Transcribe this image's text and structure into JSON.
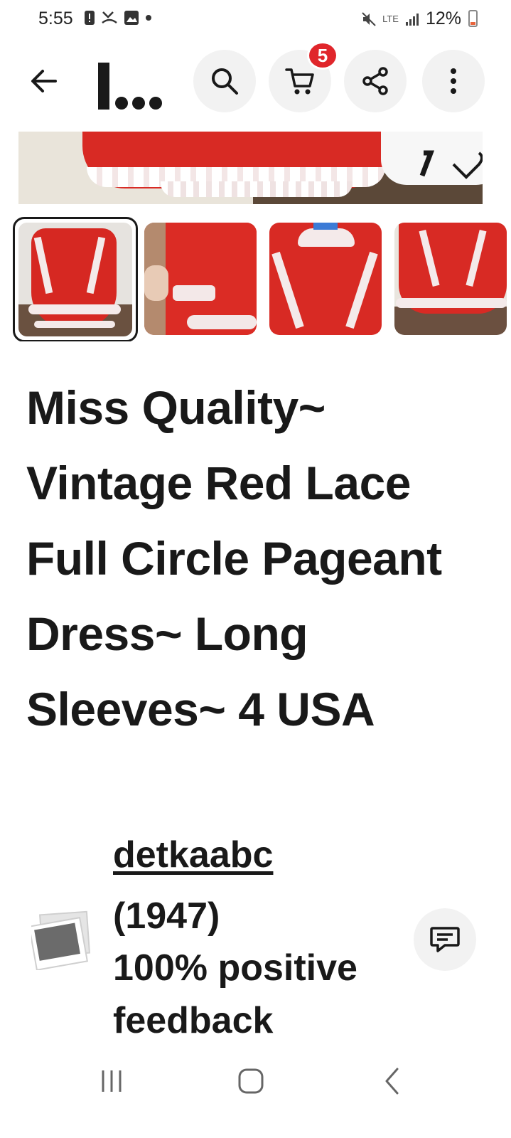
{
  "status_bar": {
    "time": "5:55",
    "network": "LTE",
    "battery": "12%",
    "icons_left": [
      "alert-icon",
      "missed-call-icon",
      "gallery-icon",
      "dot-icon"
    ],
    "icons_right": [
      "mute-icon",
      "signal-icon",
      "battery-icon"
    ]
  },
  "header": {
    "logo_icon": "ebay-logo-icon",
    "cart_count": "5",
    "icons": [
      "back-arrow-icon",
      "search-icon",
      "cart-icon",
      "share-icon",
      "more-vertical-icon"
    ]
  },
  "gallery": {
    "thumbnail_count": 4,
    "selected_index": 0
  },
  "listing": {
    "title": "Miss Quality~ Vintage Red Lace Full Circle Pageant Dress~ Long Sleeves~ 4 USA"
  },
  "seller": {
    "name": "detkaabc",
    "score": "(1947)",
    "feedback": "100% positive feedback"
  },
  "colors": {
    "text": "#191919",
    "badge": "#e0262b",
    "button_bg": "#f2f2f2",
    "dress_red": "#d82a24"
  }
}
